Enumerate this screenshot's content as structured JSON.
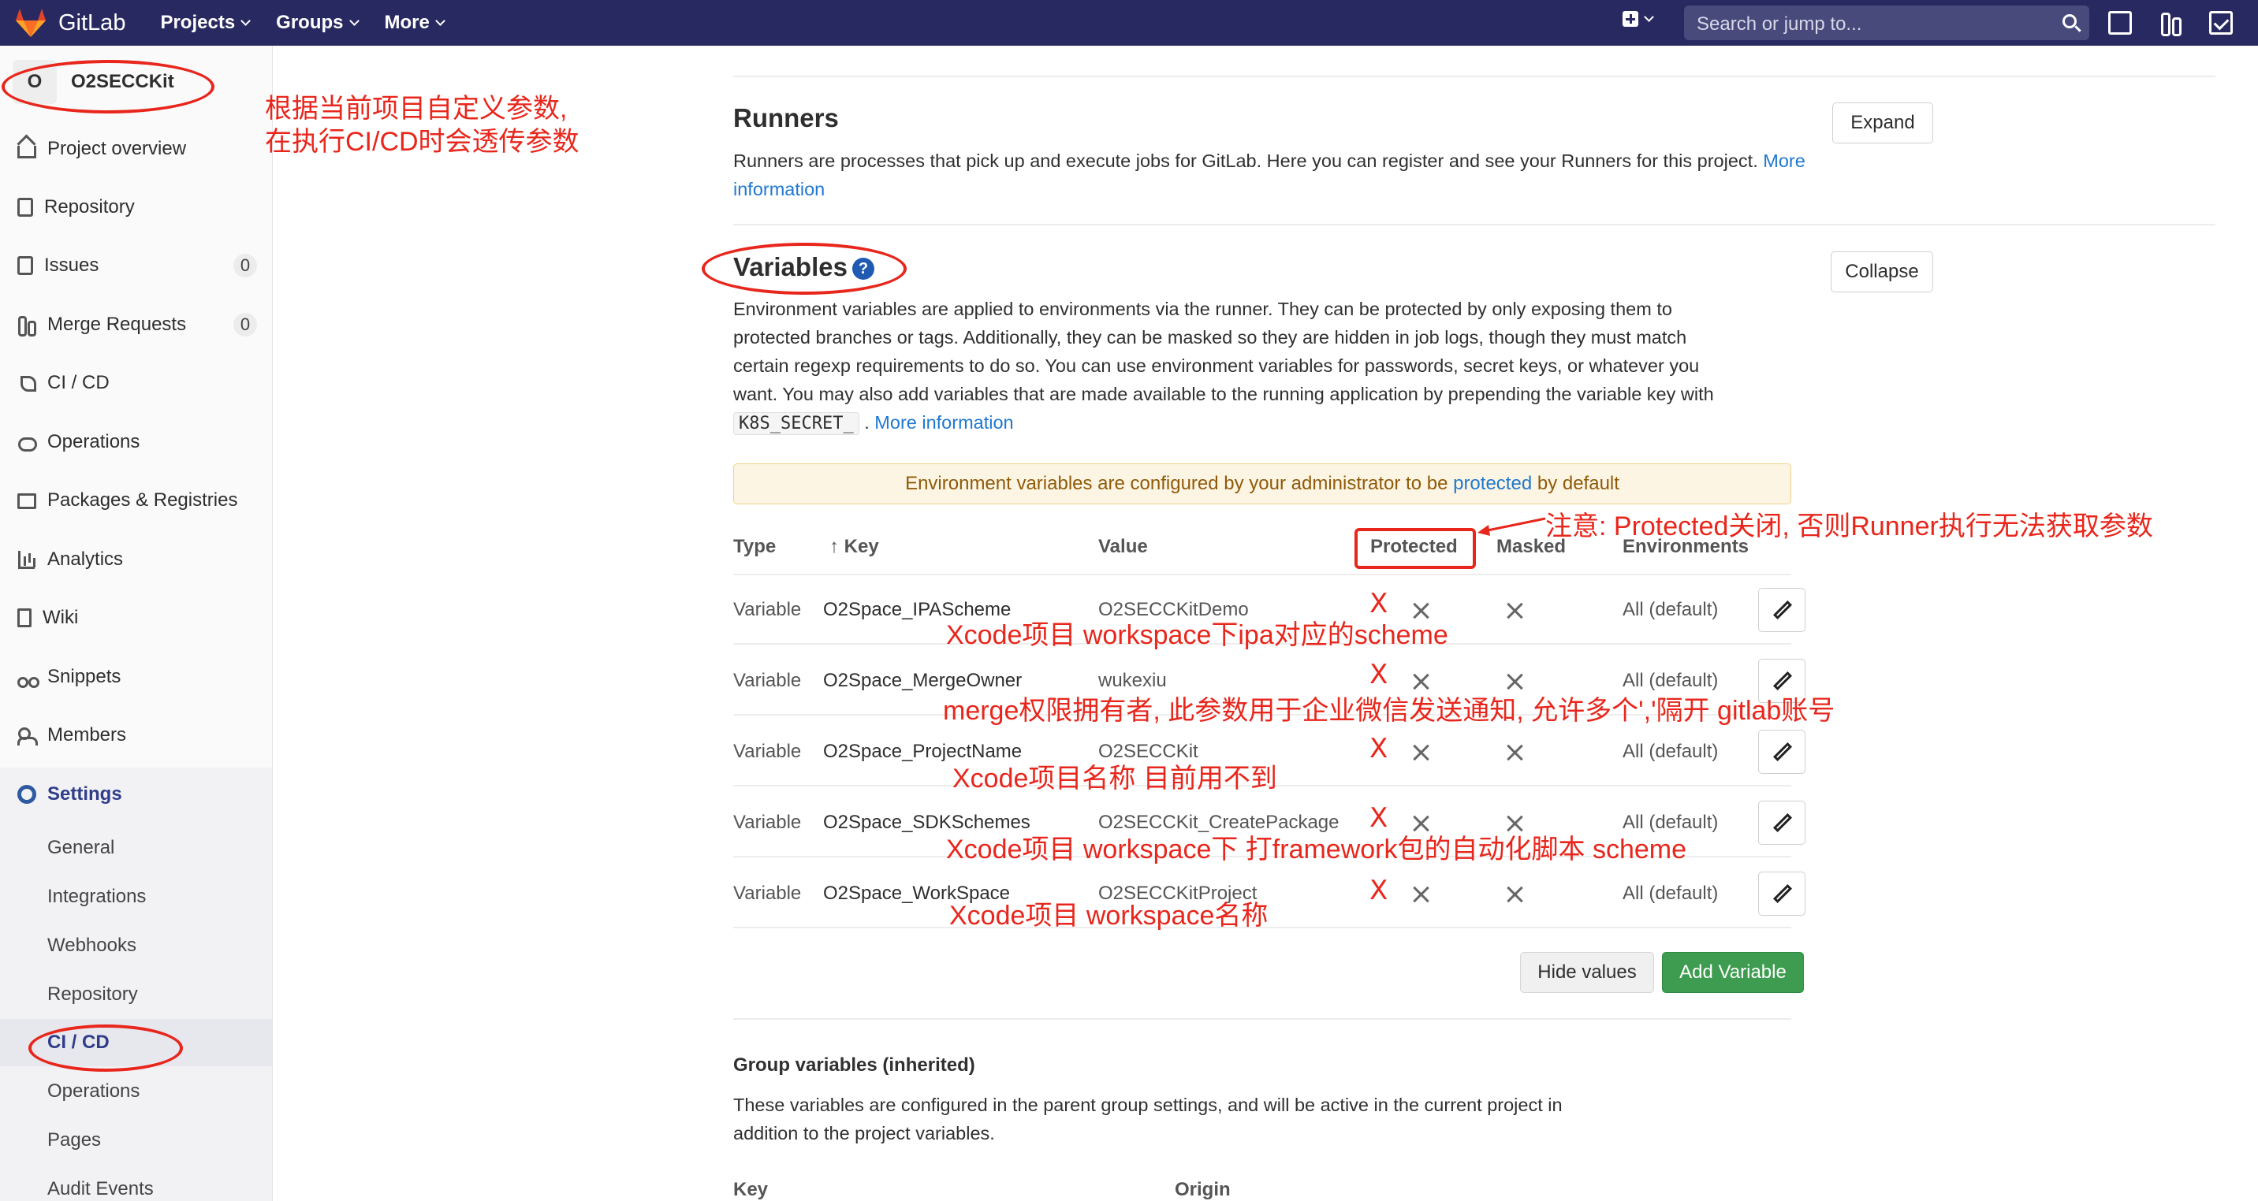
{
  "navbar": {
    "brand": "GitLab",
    "menu": [
      "Projects",
      "Groups",
      "More"
    ],
    "search_placeholder": "Search or jump to..."
  },
  "sidebar": {
    "project_initial": "O",
    "project_name": "O2SECCKit",
    "items": [
      {
        "label": "Project overview",
        "icon": "house-icon"
      },
      {
        "label": "Repository",
        "icon": "document-icon"
      },
      {
        "label": "Issues",
        "icon": "issues-icon",
        "badge": "0"
      },
      {
        "label": "Merge Requests",
        "icon": "merge-request-icon",
        "badge": "0"
      },
      {
        "label": "CI / CD",
        "icon": "rocket-icon"
      },
      {
        "label": "Operations",
        "icon": "cloud-icon"
      },
      {
        "label": "Packages & Registries",
        "icon": "package-icon"
      },
      {
        "label": "Analytics",
        "icon": "chart-icon"
      },
      {
        "label": "Wiki",
        "icon": "book-icon"
      },
      {
        "label": "Snippets",
        "icon": "scissors-icon"
      },
      {
        "label": "Members",
        "icon": "users-icon"
      }
    ],
    "settings_label": "Settings",
    "settings_sub": [
      "General",
      "Integrations",
      "Webhooks",
      "Repository",
      "CI / CD",
      "Operations",
      "Pages",
      "Audit Events"
    ],
    "active_sub": "CI / CD"
  },
  "runners": {
    "title": "Runners",
    "desc": "Runners are processes that pick up and execute jobs for GitLab. Here you can register and see your Runners for this project.",
    "more": "More information",
    "button": "Expand"
  },
  "variables": {
    "title": "Variables",
    "help": "?",
    "desc_1": "Environment variables are applied to environments via the runner. They can be protected by only exposing them to",
    "desc_2": "protected branches or tags. Additionally, they can be masked so they are hidden in job logs, though they must match",
    "desc_3": "certain regexp requirements to do so. You can use environment variables for passwords, secret keys, or whatever you",
    "desc_4": "want. You may also add variables that are made available to the running application by prepending the variable key with",
    "code": "K8S_SECRET_",
    "desc_end": ".",
    "more": "More information",
    "button": "Collapse",
    "notice_pre": "Environment variables are configured by your administrator to be",
    "notice_link": "protected",
    "notice_post": "by default",
    "headers": {
      "type": "Type",
      "key": "Key",
      "value": "Value",
      "protected": "Protected",
      "masked": "Masked",
      "environments": "Environments"
    },
    "rows": [
      {
        "type": "Variable",
        "key": "O2Space_IPAScheme",
        "value": "O2SECCKitDemo",
        "env": "All (default)"
      },
      {
        "type": "Variable",
        "key": "O2Space_MergeOwner",
        "value": "wukexiu",
        "env": "All (default)"
      },
      {
        "type": "Variable",
        "key": "O2Space_ProjectName",
        "value": "O2SECCKit",
        "env": "All (default)"
      },
      {
        "type": "Variable",
        "key": "O2Space_SDKSchemes",
        "value": "O2SECCKit_CreatePackage",
        "env": "All (default)"
      },
      {
        "type": "Variable",
        "key": "O2Space_WorkSpace",
        "value": "O2SECCKitProject",
        "env": "All (default)"
      }
    ],
    "hide_values": "Hide values",
    "add_variable": "Add Variable"
  },
  "group_vars": {
    "title": "Group variables (inherited)",
    "desc_1": "These variables are configured in the parent group settings, and will be active in the current project in",
    "desc_2": "addition to the project variables.",
    "col_key": "Key",
    "col_origin": "Origin"
  },
  "annotations": {
    "sidebar_note_1": "根据当前项目自定义参数,",
    "sidebar_note_2": "在执行CI/CD时会透传参数",
    "protected_note": "注意: Protected关闭, 否则Runner执行无法获取参数",
    "row_notes": [
      "Xcode项目 workspace下ipa对应的scheme",
      "merge权限拥有者, 此参数用于企业微信发送通知, 允许多个','隔开 gitlab账号",
      "Xcode项目名称 目前用不到",
      "Xcode项目 workspace下 打framework包的自动化脚本 scheme",
      "Xcode项目 workspace名称"
    ],
    "x_mark": "X"
  },
  "colors": {
    "navbar": "#292961",
    "accent": "#1f78d1",
    "annotation": "#e8261c",
    "success": "#3d9c4f"
  }
}
